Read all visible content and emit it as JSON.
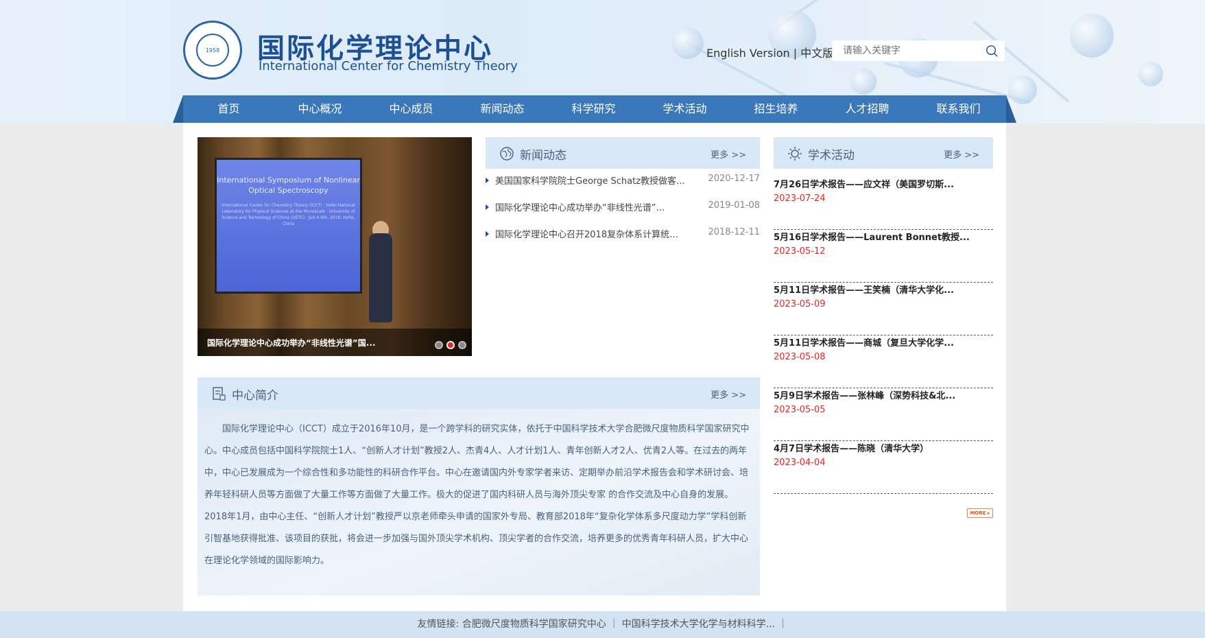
{
  "header": {
    "title_cn": "国际化学理论中心",
    "title_en": "International Center for Chemistry Theory",
    "logo_year": "1958",
    "lang_en": "English Version",
    "lang_sep": " | ",
    "lang_cn": "中文版",
    "search_placeholder": "请输入关键字"
  },
  "nav": [
    "首页",
    "中心概况",
    "中心成员",
    "新闻动态",
    "科学研究",
    "学术活动",
    "招生培养",
    "人才招聘",
    "联系我们"
  ],
  "slider": {
    "caption": "国际化学理论中心成功举办“非线性光谱”国...",
    "screen_title": "International Symposium of Nonlinear Optical Spectroscopy",
    "screen_sub": "International Center for Chemistry Theory (ICCT) · Hefei National Laboratory for Physical Sciences at the Microscale · University of Science and Technology of China (USTC) · Jun 4-6th, 2018, Hefei, China",
    "active_dot": 2
  },
  "news": {
    "heading": "新闻动态",
    "more": "更多 >>",
    "items": [
      {
        "title": "美国国家科学院院士George Schatz教授做客...",
        "date": "2020-12-17"
      },
      {
        "title": "国际化学理论中心成功举办“非线性光谱”…",
        "date": "2019-01-08"
      },
      {
        "title": "国际化学理论中心召开2018复杂体系计算统…",
        "date": "2018-12-11"
      }
    ]
  },
  "activities": {
    "heading": "学术活动",
    "more": "更多 >>",
    "more_btn": "MORE ▸",
    "items": [
      {
        "title": "7月26日学术报告——应文祥（美国罗切斯...",
        "date": "2023-07-24"
      },
      {
        "title": "5月16日学术报告——Laurent Bonnet教授...",
        "date": "2023-05-12"
      },
      {
        "title": "5月11日学术报告——王笑楠（清华大学化...",
        "date": "2023-05-09"
      },
      {
        "title": "5月11日学术报告——商城（复旦大学化学...",
        "date": "2023-05-08"
      },
      {
        "title": "5月9日学术报告——张林峰（深势科技&北...",
        "date": "2023-05-05"
      },
      {
        "title": "4月7日学术报告——陈晓（清华大学）",
        "date": "2023-04-04"
      }
    ]
  },
  "intro": {
    "heading": "中心简介",
    "more": "更多 >>",
    "text": "国际化学理论中心（ICCT）成立于2016年10月，是一个跨学科的研究实体，依托于中国科学技术大学合肥微尺度物质科学国家研究中心。中心成员包括中国科学院院士1人、“创新人才计划”教授2人、杰青4人、人才计划1人、青年创新人才2人、优青2人等。在过去的两年中，中心已发展成为一个综合性和多功能性的科研合作平台。中心在邀请国内外专家学者来访、定期举办前沿学术报告会和学术研讨会、培养年轻科研人员等方面做了大量工作等方面做了大量工作。极大的促进了国内科研人员与海外顶尖专家 的合作交流及中心自身的发展。2018年1月，由中心主任、“创新人才计划”教授严以京老师牵头申请的国家外专局、教育部2018年“复杂化学体系多尺度动力学”学科创新引智基地获得批准、该项目的获批，将会进一步加强与国外顶尖学术机构、顶尖学者的合作交流，培养更多的优秀青年科研人员，扩大中心在理论化学领域的国际影响力。"
  },
  "footer": {
    "label": "友情链接:",
    "link1": "合肥微尺度物质科学国家研究中心",
    "link2": "中国科学技术大学化学与材料科学...",
    "sep": " ｜"
  },
  "colors": {
    "nav": "#3b78bb",
    "title": "#1d4f95",
    "date_red": "#e22222",
    "panel_head": "#d9e8f7"
  }
}
